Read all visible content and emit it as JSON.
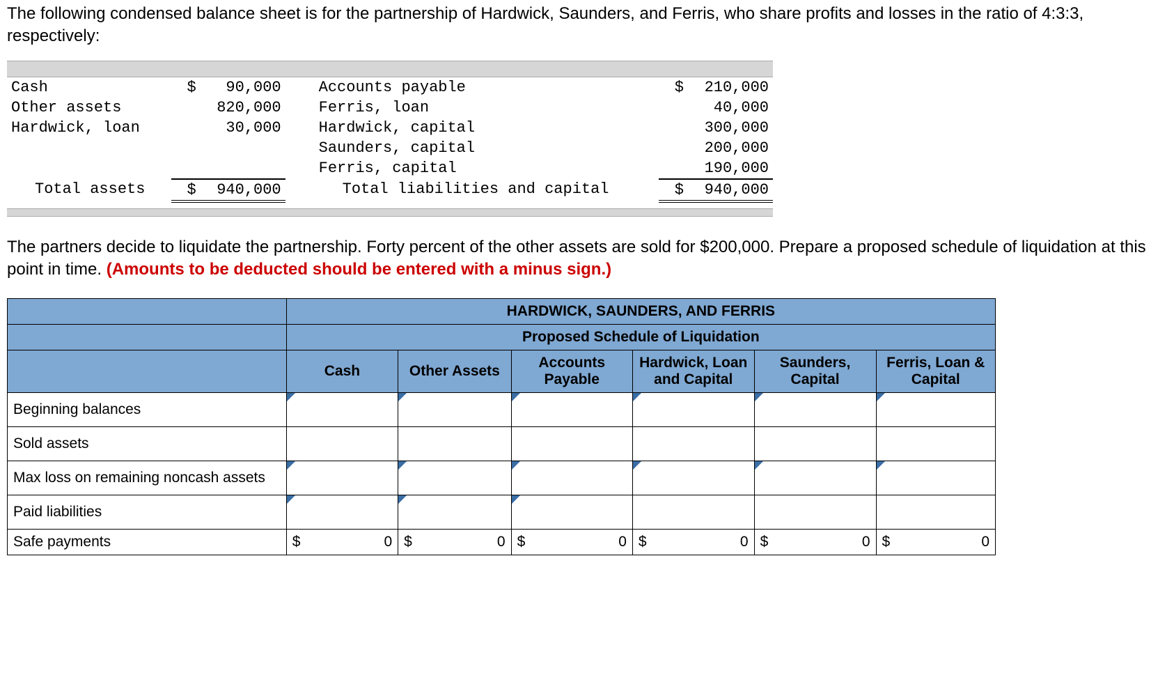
{
  "intro": "The following condensed balance sheet is for the partnership of Hardwick, Saunders, and Ferris, who share profits and losses in the ratio of 4:3:3, respectively:",
  "balance": {
    "left": [
      {
        "label": "Cash",
        "cur": "$",
        "amount": "90,000"
      },
      {
        "label": "Other assets",
        "cur": "",
        "amount": "820,000"
      },
      {
        "label": "Hardwick, loan",
        "cur": "",
        "amount": "30,000"
      }
    ],
    "right": [
      {
        "label": "Accounts payable",
        "cur": "$",
        "amount": "210,000"
      },
      {
        "label": "Ferris, loan",
        "cur": "",
        "amount": "40,000"
      },
      {
        "label": "Hardwick, capital",
        "cur": "",
        "amount": "300,000"
      },
      {
        "label": "Saunders, capital",
        "cur": "",
        "amount": "200,000"
      },
      {
        "label": "Ferris, capital",
        "cur": "",
        "amount": "190,000"
      }
    ],
    "total_left_label": "Total assets",
    "total_left_cur": "$",
    "total_left_amount": "940,000",
    "total_right_label": "Total liabilities and capital",
    "total_right_cur": "$",
    "total_right_amount": "940,000"
  },
  "midtext_a": "The partners decide to liquidate the partnership. Forty percent of the other assets are sold for $200,000. Prepare a proposed schedule of liquidation at this point in time. ",
  "midtext_red": "(Amounts to be deducted should be entered with a minus sign.)",
  "schedule": {
    "title1": "HARDWICK, SAUNDERS, AND FERRIS",
    "title2": "Proposed Schedule of Liquidation",
    "cols": [
      "Cash",
      "Other Assets",
      "Accounts Payable",
      "Hardwick, Loan and Capital",
      "Saunders, Capital",
      "Ferris, Loan & Capital"
    ],
    "rows": [
      "Beginning balances",
      "Sold assets",
      "Max loss on remaining noncash assets",
      "Paid liabilities"
    ],
    "safe_label": "Safe payments",
    "safe_values": [
      {
        "cur": "$",
        "num": "0"
      },
      {
        "cur": "$",
        "num": "0"
      },
      {
        "cur": "$",
        "num": "0"
      },
      {
        "cur": "$",
        "num": "0"
      },
      {
        "cur": "$",
        "num": "0"
      },
      {
        "cur": "$",
        "num": "0"
      }
    ]
  }
}
